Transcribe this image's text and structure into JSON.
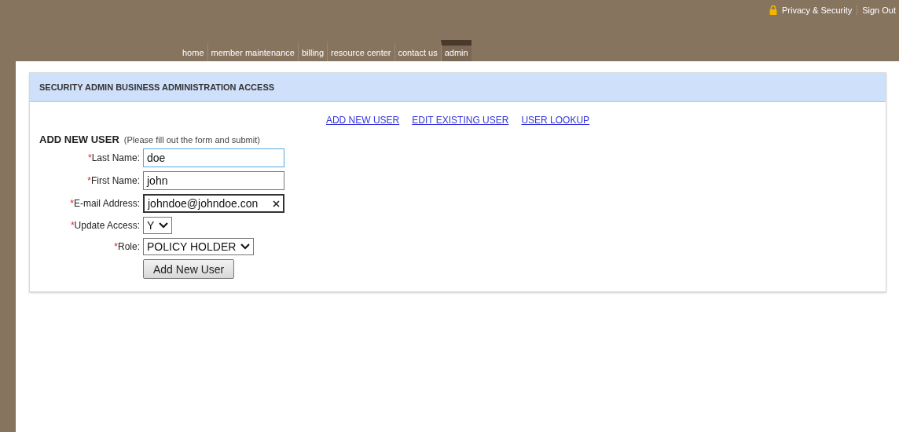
{
  "header": {
    "utility_links": [
      "Privacy & Security",
      "Sign Out"
    ],
    "nav": [
      {
        "label": "home",
        "selected": false
      },
      {
        "label": "member maintenance",
        "selected": false
      },
      {
        "label": "billing",
        "selected": false
      },
      {
        "label": "resource center",
        "selected": false
      },
      {
        "label": "contact us",
        "selected": false
      },
      {
        "label": "admin",
        "selected": true
      }
    ]
  },
  "panel": {
    "title": "SECURITY ADMIN BUSINESS ADMINISTRATION ACCESS",
    "links": [
      "ADD NEW USER",
      "EDIT EXISTING USER",
      "USER LOOKUP"
    ],
    "form_title": "ADD NEW USER",
    "form_hint": "(Please fill out the form and submit)",
    "fields": [
      {
        "kind": "text",
        "label": "Last Name:",
        "required_mark": "*",
        "value": "doe",
        "focused": true,
        "clearable": false
      },
      {
        "kind": "text",
        "label": "First Name:",
        "required_mark": "*",
        "value": "john",
        "focused": false,
        "clearable": false
      },
      {
        "kind": "text",
        "label": "E-mail Address:",
        "required_mark": "*",
        "value": "johndoe@johndoe.con",
        "focused": false,
        "clearable": true
      },
      {
        "kind": "select",
        "label": "Update Access:",
        "required_mark": "*",
        "value": "Y"
      },
      {
        "kind": "select",
        "label": "Role:",
        "required_mark": "*",
        "value": "POLICY HOLDER"
      }
    ],
    "submit": "Add New User"
  }
}
